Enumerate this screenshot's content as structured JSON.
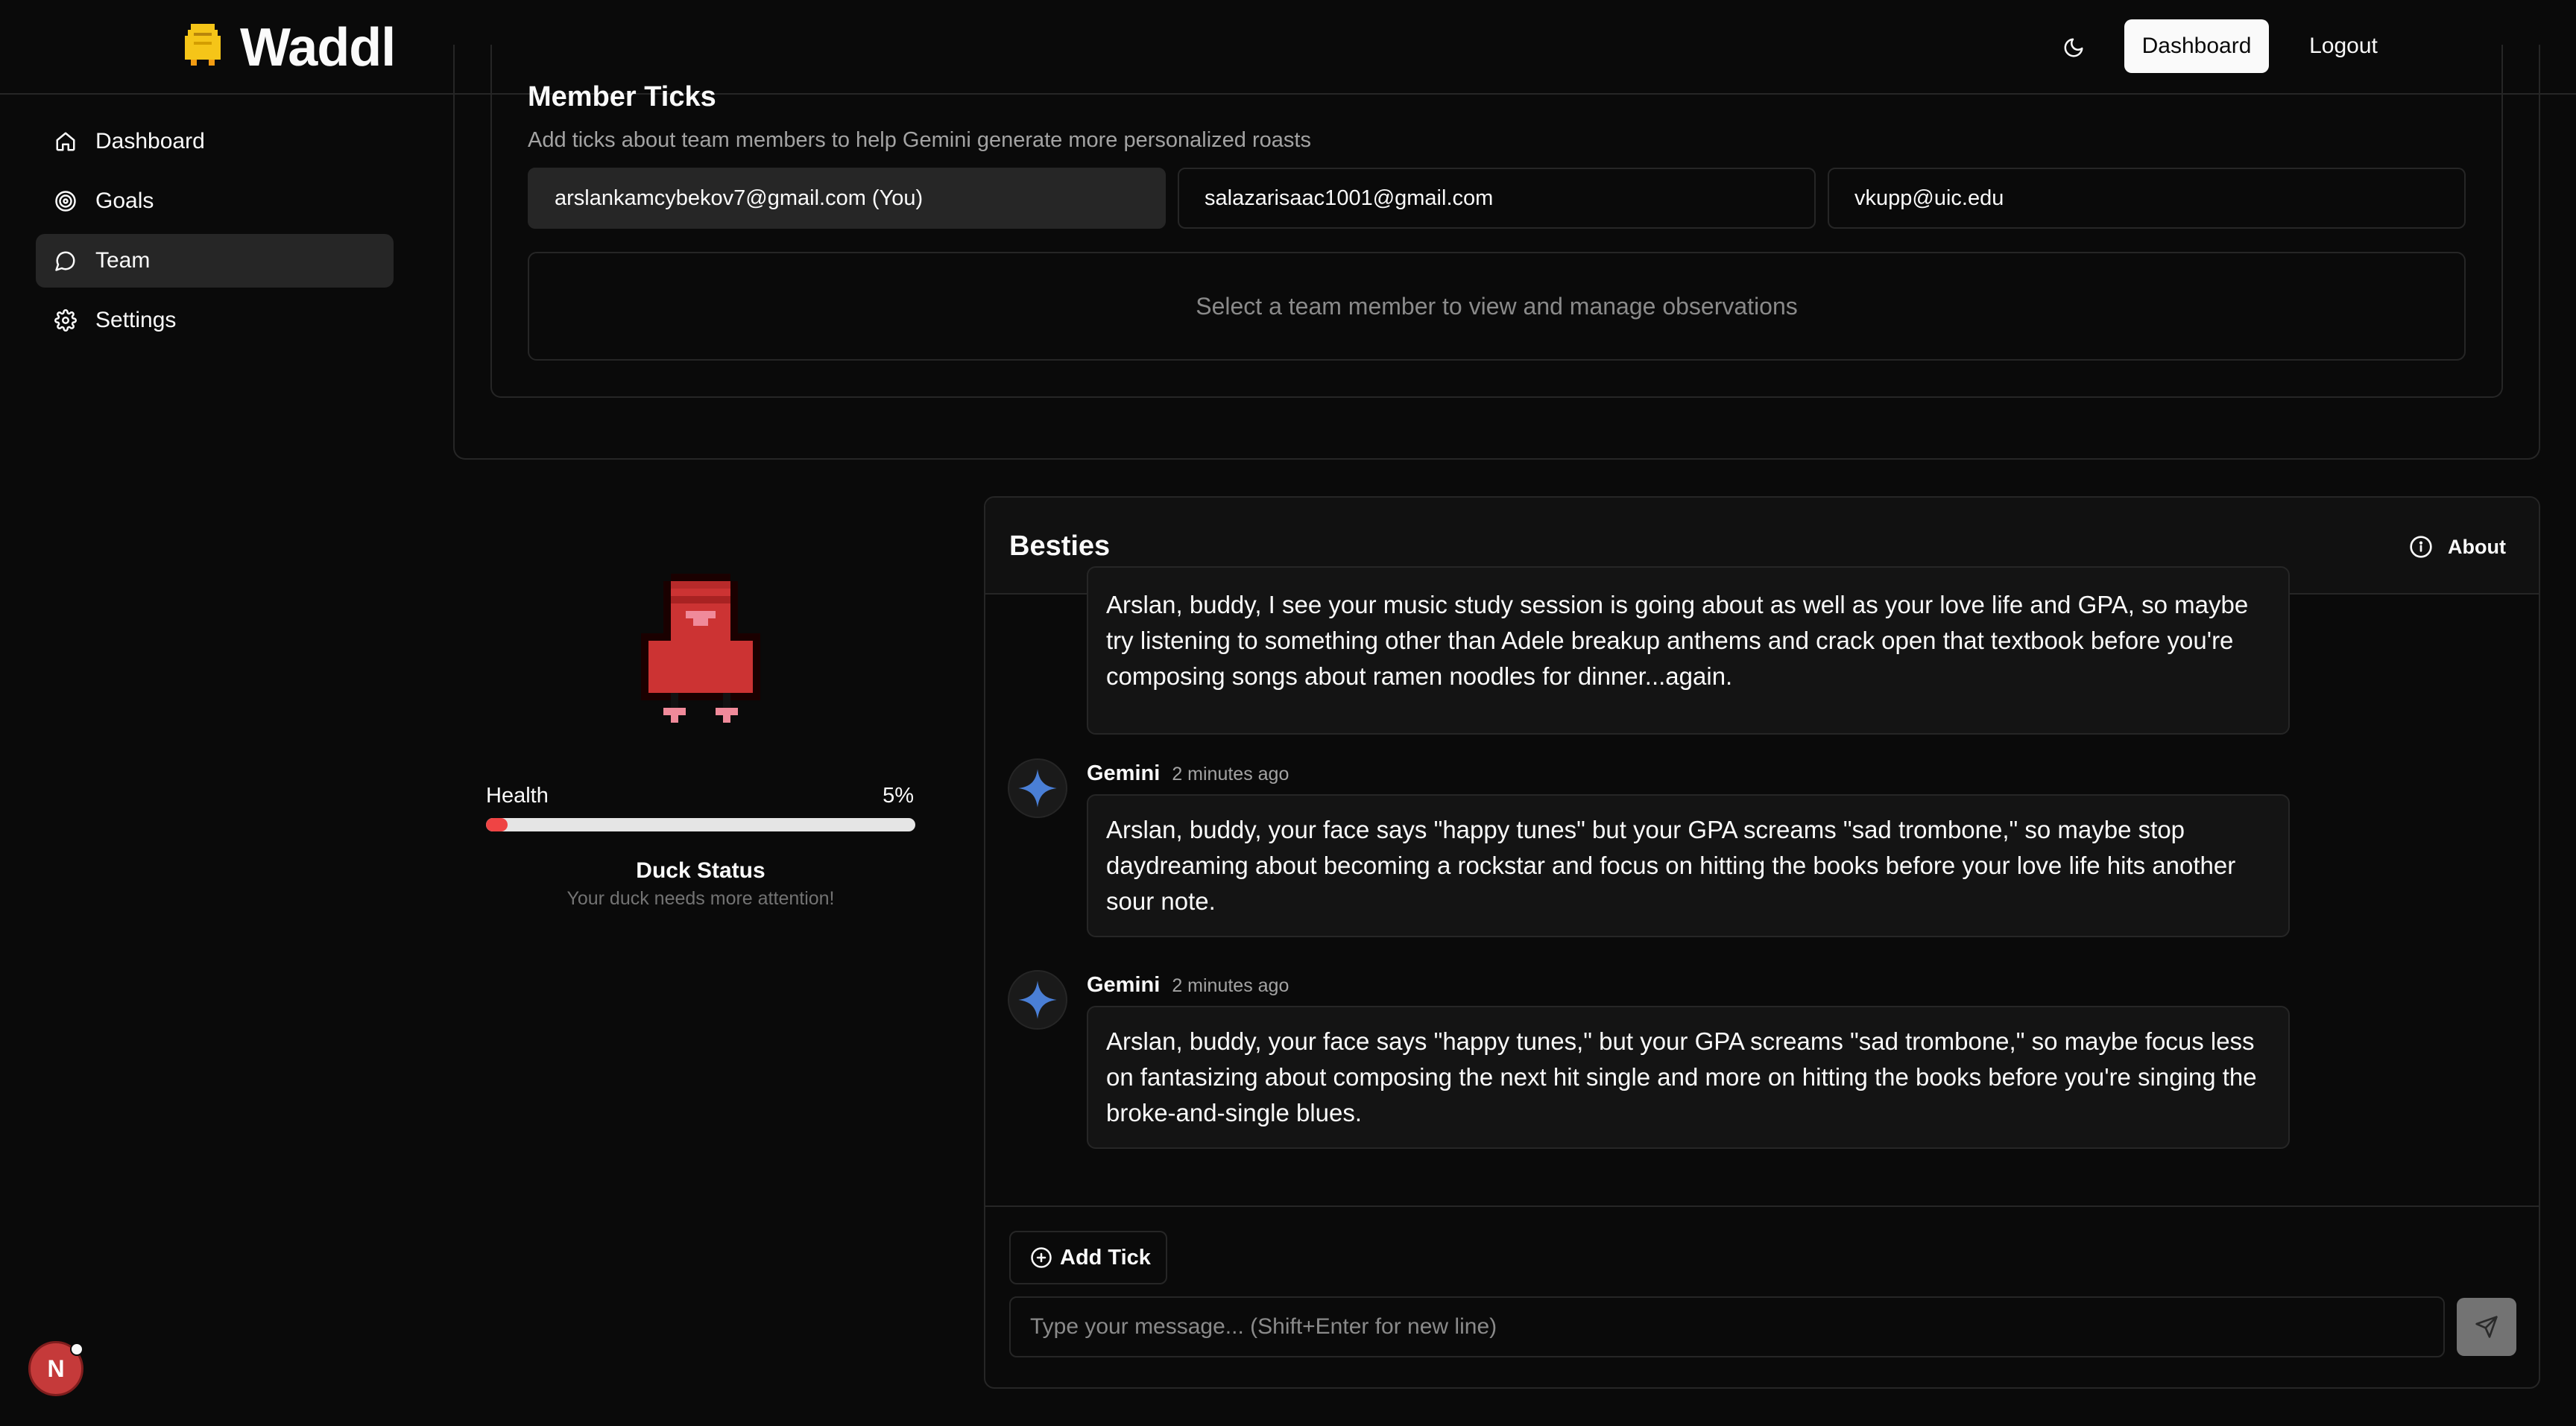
{
  "header": {
    "brand": "Waddl",
    "logo_icon": "duck-logo-icon",
    "theme_icon": "moon-icon",
    "dashboard_label": "Dashboard",
    "logout_label": "Logout"
  },
  "sidebar": {
    "items": [
      {
        "label": "Dashboard",
        "icon": "home-icon",
        "active": false
      },
      {
        "label": "Goals",
        "icon": "target-icon",
        "active": false
      },
      {
        "label": "Team",
        "icon": "chat-bubble-icon",
        "active": true
      },
      {
        "label": "Settings",
        "icon": "gear-icon",
        "active": false
      }
    ]
  },
  "ticks": {
    "title": "Member Ticks",
    "subtitle": "Add ticks about team members to help Gemini generate more personalized roasts",
    "members": [
      {
        "label": "arslankamcybekov7@gmail.com (You)",
        "selected": true
      },
      {
        "label": "salazarisaac1001@gmail.com",
        "selected": false
      },
      {
        "label": "vkupp@uic.edu",
        "selected": false
      }
    ],
    "empty_text": "Select a team member to view and manage observations"
  },
  "duck": {
    "health_label": "Health",
    "health_value": "5%",
    "health_fraction": 0.05,
    "status_title": "Duck Status",
    "status_hint": "Your duck needs more attention!",
    "colors": {
      "body": "#cc3333",
      "accent": "#f08a9a"
    }
  },
  "chat": {
    "title": "Besties",
    "about_label": "About",
    "about_icon": "info-icon",
    "partial_message": "Arslan, buddy, I see your music study session is going about as well as your love life and GPA, so maybe try listening to something other than Adele breakup anthems and crack open that textbook before you're composing songs about ramen noodles for dinner...again.",
    "messages": [
      {
        "author": "Gemini",
        "time": "2 minutes ago",
        "text": "Arslan, buddy, your face says \"happy tunes\" but your GPA screams \"sad trombone,\" so maybe stop daydreaming about becoming a rockstar and focus on hitting the books before your love life hits another sour note."
      },
      {
        "author": "Gemini",
        "time": "2 minutes ago",
        "text": "Arslan, buddy, your face says \"happy tunes,\" but your GPA screams \"sad trombone,\" so maybe focus less on fantasizing about composing the next hit single and more on hitting the books before you're singing the broke-and-single blues."
      }
    ],
    "add_tick_label": "Add Tick",
    "input_placeholder": "Type your message... (Shift+Enter for new line)",
    "input_value": "",
    "send_icon": "send-icon"
  },
  "user": {
    "initial": "N"
  }
}
